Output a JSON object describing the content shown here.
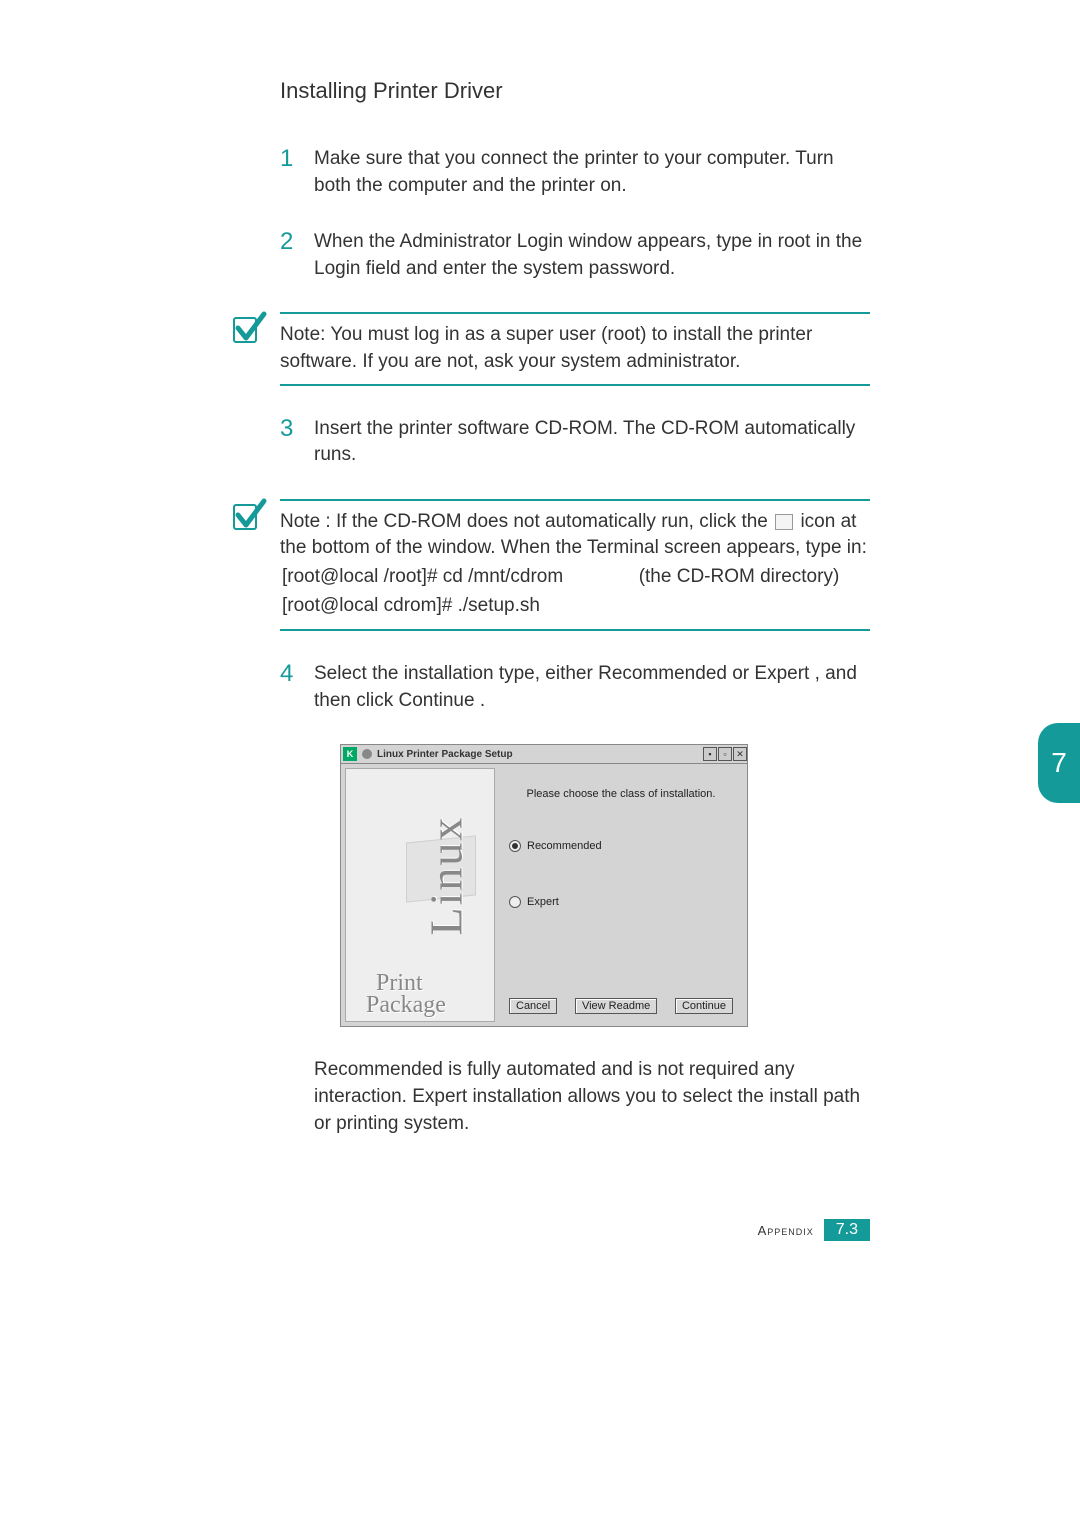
{
  "heading": "Installing Printer Driver",
  "steps": {
    "s1": {
      "num": "1",
      "text_a": "Make sure that you connect the printer to your computer. Turn both the computer and the printer on."
    },
    "s2": {
      "num": "2",
      "pre": "When the Administrator Login window appears, type in ",
      "root": "root",
      "post": " in the Login field and enter the system password."
    },
    "s3": {
      "num": "3",
      "text": "Insert the printer software CD-ROM. The CD-ROM automatically runs."
    },
    "s4": {
      "num": "4",
      "pre": "Select the installation type, either ",
      "opt1": "Recommended",
      "mid": " or ",
      "opt2": "Expert",
      "post1": ", and then click ",
      "btn": "Continue",
      "post2": " ."
    }
  },
  "note1": {
    "label": "Note:",
    "text": " You must log in as a super user (root) to install the printer software. If you are not, ask your system administrator."
  },
  "note2": {
    "label": "Note",
    "lead": " : If the CD-ROM does not automatically run, click the ",
    "lead2": "icon at the bottom of the window. When the Terminal screen appears, type in:",
    "cmd1": "[root@local /root]# cd /mnt/cdrom",
    "cmd1_hint": "(the CD-ROM directory)",
    "cmd2": "[root@local cdrom]# ./setup.sh"
  },
  "screenshot": {
    "title": "Linux Printer Package Setup",
    "left_linux": "Linux",
    "left_print": "Print",
    "left_package": "Package",
    "prompt": "Please choose the class of installation.",
    "radio_recommended": "Recommended",
    "radio_expert": "Expert",
    "btn_cancel": "Cancel",
    "btn_readme": "View Readme",
    "btn_continue": "Continue"
  },
  "after": {
    "rec": "Recommended",
    "rec_txt": " is fully automated and is not required any interaction. ",
    "exp": "Expert",
    "exp_txt": " installation allows you to select the install path or printing system."
  },
  "side_tab": "7",
  "footer": {
    "label": "Appendix",
    "page": "7.3"
  }
}
